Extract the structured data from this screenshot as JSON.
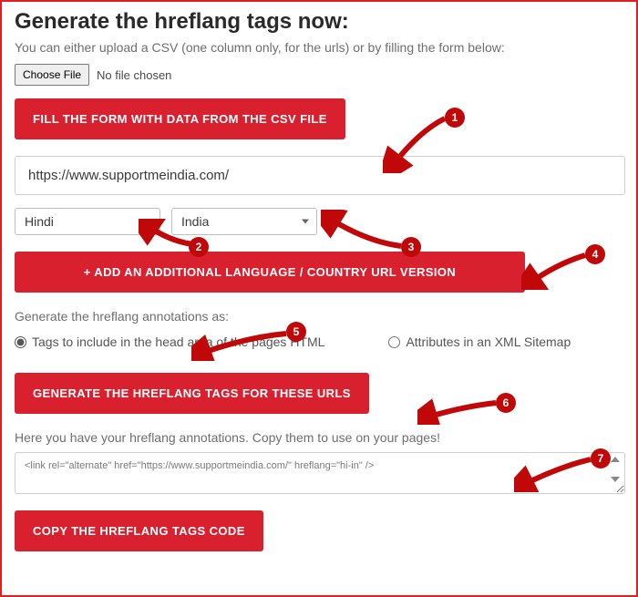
{
  "title": "Generate the hreflang tags now:",
  "subtext": "You can either upload a CSV (one column only, for the urls) or by filling the form below:",
  "file": {
    "button_label": "Choose File",
    "status": "No file chosen"
  },
  "buttons": {
    "fill_from_csv": "FILL THE FORM WITH DATA FROM THE CSV FILE",
    "add_version": "+ ADD AN ADDITIONAL LANGUAGE / COUNTRY URL VERSION",
    "generate": "GENERATE THE HREFLANG TAGS FOR THESE URLS",
    "copy": "COPY THE HREFLANG TAGS CODE"
  },
  "url_input": {
    "value": "https://www.supportmeindia.com/"
  },
  "selects": {
    "language": "Hindi",
    "country": "India"
  },
  "annotations_label": "Generate the hreflang annotations as:",
  "radios": {
    "head": "Tags to include in the head area of the pages HTML",
    "sitemap": "Attributes in an XML Sitemap",
    "selected": "head"
  },
  "output_label": "Here you have your hreflang annotations. Copy them to use on your pages!",
  "output_value": "<link rel=\"alternate\" href=\"https://www.supportmeindia.com/\" hreflang=\"hi-in\" />",
  "callouts": [
    "1",
    "2",
    "3",
    "4",
    "5",
    "6",
    "7"
  ]
}
